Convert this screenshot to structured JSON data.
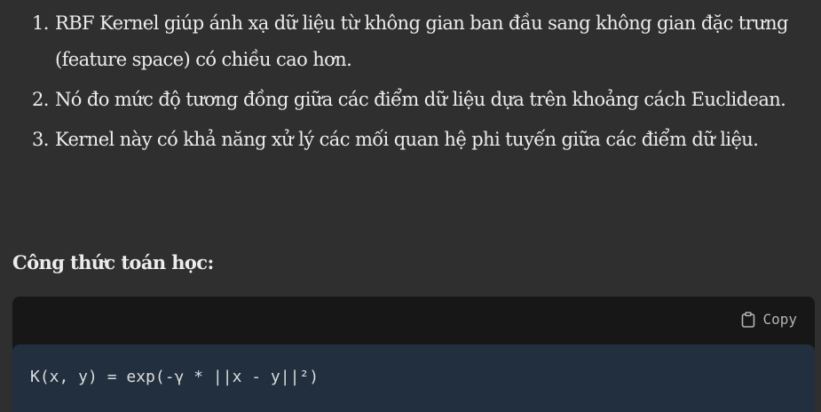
{
  "points": [
    {
      "number": "1.",
      "text": "RBF Kernel giúp ánh xạ dữ liệu từ không gian ban đầu sang không gian đặc trưng (feature space) có chiều cao hơn."
    },
    {
      "number": "2.",
      "text": "Nó đo mức độ tương đồng giữa các điểm dữ liệu dựa trên khoảng cách Euclidean."
    },
    {
      "number": "3.",
      "text": "Kernel này có khả năng xử lý các mối quan hệ phi tuyến giữa các điểm dữ liệu."
    }
  ],
  "heading": "Công thức toán học:",
  "code_block": {
    "copy_label": "Copy",
    "copy_icon": "clipboard-icon",
    "code": "K(x, y) = exp(-γ * ||x - y||²)"
  },
  "colors": {
    "background": "#2f2f30",
    "text": "#ececec",
    "code_header_bg": "#171717",
    "code_body_bg": "#212f3e"
  }
}
